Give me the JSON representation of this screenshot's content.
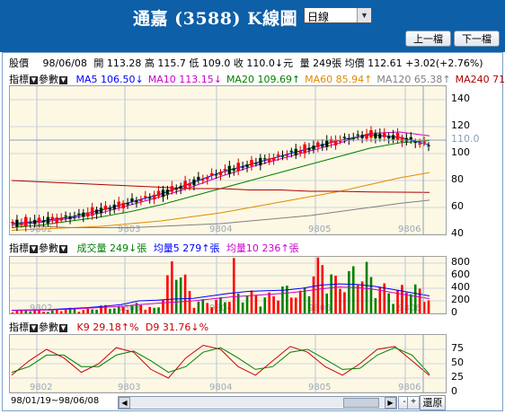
{
  "header": {
    "title": "通嘉 (3588) K線圖",
    "period_selected": "日線",
    "prev_button": "上一檔",
    "next_button": "下一檔"
  },
  "quote": {
    "stock_label": "股價",
    "date": "98/06/08",
    "open_label": "開",
    "open": "113.28",
    "high_label": "高",
    "high": "115.7",
    "low_label": "低",
    "low": "109.0",
    "close_label": "收",
    "close": "110.0",
    "close_arrow": "↓",
    "close_unit": "元",
    "volume_label": "量",
    "volume": "249張",
    "avg_label": "均價",
    "avg": "112.61",
    "change": "+3.02(+2.76%)"
  },
  "controls": {
    "indicator": "指標",
    "params": "參數"
  },
  "price_legend": [
    {
      "label": "MA5",
      "value": "106.50",
      "arrow": "↓",
      "color": "#0000ff"
    },
    {
      "label": "MA10",
      "value": "113.15",
      "arrow": "↓",
      "color": "#cc00cc"
    },
    {
      "label": "MA20",
      "value": "109.69",
      "arrow": "↑",
      "color": "#008000"
    },
    {
      "label": "MA60",
      "value": "85.94",
      "arrow": "↑",
      "color": "#e08a00"
    },
    {
      "label": "MA120",
      "value": "65.38",
      "arrow": "↑",
      "color": "#808080"
    },
    {
      "label": "MA240",
      "value": "71.21",
      "arrow": "",
      "color": "#b00000"
    }
  ],
  "volume_legend": {
    "vol_label": "成交量",
    "vol_value": "249",
    "vol_arrow": "↓",
    "vol_unit": "張",
    "avg5_label": "均量5",
    "avg5_value": "279",
    "avg5_arrow": "↑",
    "avg5_unit": "張",
    "avg10_label": "均量10",
    "avg10_value": "236",
    "avg10_arrow": "↑",
    "avg10_unit": "張"
  },
  "kd_legend": {
    "k_label": "K9",
    "k_value": "29.18",
    "k_arrow": "↑",
    "k_unit": "%",
    "d_label": "D9",
    "d_value": "31.76",
    "d_arrow": "↓",
    "d_unit": "%"
  },
  "price_axis": {
    "ticks": [
      "140",
      "120",
      "110.0",
      "100",
      "80",
      "60",
      "40"
    ]
  },
  "volume_axis": {
    "ticks": [
      "800",
      "600",
      "400",
      "200",
      "0"
    ]
  },
  "kd_axis": {
    "ticks": [
      "75",
      "50",
      "25",
      "0"
    ]
  },
  "month_labels": [
    "9802",
    "9803",
    "9804",
    "9805",
    "9806"
  ],
  "current_price_marker": "110.0",
  "date_range": "98/01/19~98/06/08",
  "zoom_out": "-",
  "zoom_in": "+",
  "restore_button": "還原",
  "colors": {
    "header_bg": "#0d5fa8",
    "panel_bg": "#fdf8e4",
    "up": "#ff0000",
    "down": "#008000",
    "ma5": "#0000ff",
    "ma10": "#cc00cc",
    "ma20": "#008000",
    "ma60": "#e08a00",
    "ma120": "#808080",
    "ma240": "#b00000",
    "k_line": "#cc0000",
    "d_line": "#008000"
  },
  "chart_data": [
    {
      "type": "candlestick",
      "ylim": [
        40,
        150
      ],
      "month_labels": [
        "9802",
        "9803",
        "9804",
        "9805",
        "9806"
      ],
      "series": [
        {
          "name": "MA5",
          "values": [
            48,
            50,
            53,
            58,
            64,
            70,
            78,
            86,
            92,
            98,
            104,
            110,
            114,
            112,
            106.5
          ]
        },
        {
          "name": "MA10",
          "values": [
            47,
            49,
            52,
            56,
            62,
            68,
            75,
            83,
            90,
            96,
            102,
            108,
            115,
            116,
            113.15
          ]
        },
        {
          "name": "MA20",
          "values": [
            45,
            47,
            50,
            53,
            57,
            62,
            68,
            74,
            80,
            86,
            92,
            98,
            104,
            108,
            109.69
          ]
        },
        {
          "name": "MA60",
          "values": [
            43,
            44,
            45,
            46,
            48,
            50,
            53,
            56,
            60,
            64,
            68,
            72,
            77,
            82,
            85.94
          ]
        },
        {
          "name": "MA120",
          "values": [
            47,
            46,
            45,
            45,
            45,
            46,
            47,
            48,
            50,
            52,
            54,
            57,
            60,
            63,
            65.38
          ]
        },
        {
          "name": "MA240",
          "values": [
            80,
            79,
            78,
            77,
            76,
            75,
            74,
            74,
            73,
            73,
            72,
            72,
            71.5,
            71.3,
            71.21
          ]
        }
      ],
      "last_close": 110.0
    },
    {
      "type": "bar",
      "ylim": [
        0,
        900
      ],
      "values": [
        40,
        60,
        30,
        80,
        50,
        120,
        90,
        150,
        60,
        900,
        200,
        180,
        260,
        320,
        250,
        400,
        300,
        850,
        450,
        700,
        520,
        300,
        460,
        249
      ],
      "avg5": [
        50,
        55,
        60,
        75,
        90,
        110,
        140,
        200,
        210,
        230,
        240,
        280,
        320,
        350,
        360,
        370,
        400,
        450,
        470,
        460,
        430,
        380,
        330,
        279
      ],
      "avg10": [
        45,
        50,
        55,
        65,
        80,
        95,
        110,
        140,
        160,
        180,
        200,
        230,
        260,
        280,
        300,
        320,
        350,
        390,
        420,
        410,
        380,
        330,
        280,
        236
      ]
    },
    {
      "type": "line",
      "ylim": [
        0,
        100
      ],
      "series": [
        {
          "name": "K9",
          "values": [
            30,
            55,
            75,
            60,
            35,
            50,
            78,
            70,
            40,
            25,
            60,
            82,
            75,
            45,
            30,
            55,
            80,
            70,
            45,
            30,
            50,
            75,
            80,
            55,
            29.18
          ]
        },
        {
          "name": "D9",
          "values": [
            35,
            45,
            65,
            65,
            45,
            45,
            65,
            72,
            55,
            35,
            45,
            70,
            78,
            60,
            40,
            45,
            70,
            75,
            58,
            40,
            42,
            65,
            78,
            65,
            31.76
          ]
        }
      ]
    }
  ]
}
